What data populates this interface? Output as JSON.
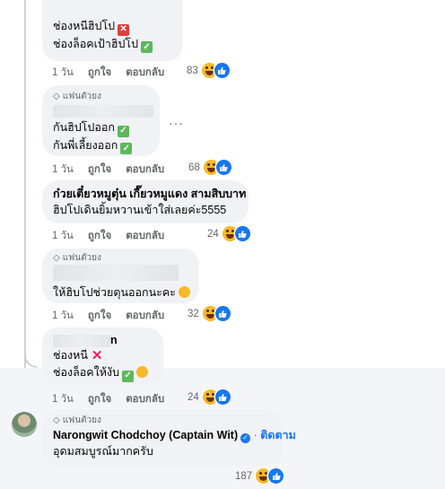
{
  "comments": [
    {
      "lines": [
        "ช่องหนีฮิปโป",
        "ช่องล็อคเป้าฮิปโป"
      ],
      "time": "1 วัน",
      "like_label": "ถูกใจ",
      "reply_label": "ตอบกลับ",
      "reaction_count": "83"
    },
    {
      "badge": "แฟนตัวยง",
      "lines": [
        "กันฮิปโปออก",
        "กันพี่เลี้ยงออก"
      ],
      "time": "1 วัน",
      "like_label": "ถูกใจ",
      "reply_label": "ตอบกลับ",
      "reaction_count": "68",
      "more": "···"
    },
    {
      "lines": [
        "ก๋วยเตี๋ยวหมูตุ๋น เกี๊ยวหมูแดง สามสิบบาท",
        "ฮิปโปเดินยิ้มหวานเข้าใส่เลยค่ะ5555"
      ],
      "time": "1 วัน",
      "like_label": "ถูกใจ",
      "reply_label": "ตอบกลับ",
      "reaction_count": "24"
    },
    {
      "badge": "แฟนตัวยง",
      "lines": [
        "ให้ฮิบโปช่วยดุนออกนะคะ"
      ],
      "time": "1 วัน",
      "like_label": "ถูกใจ",
      "reply_label": "ตอบกลับ",
      "reaction_count": "32"
    },
    {
      "name_tail": "n",
      "lines": [
        "ช่องหนี",
        "ช่องล็อคให้งับ"
      ],
      "time": "1 วัน",
      "like_label": "ถูกใจ",
      "reply_label": "ตอบกลับ",
      "reaction_count": "24"
    },
    {
      "badge": "แฟนตัวยง",
      "author": "Narongwit Chodchoy (Captain Wit)",
      "follow_label": "ติดตาม",
      "lines": [
        "อุดมสมบูรณ์มากครับ"
      ],
      "reaction_count": "187"
    }
  ],
  "icons": {
    "check": "check-mark-button-emoji",
    "cross": "cross-mark-emoji",
    "laugh": "grinning-squinting-face-emoji",
    "haha": "haha-reaction-icon",
    "like": "like-reaction-icon"
  },
  "colors": {
    "accent": "#1877f2",
    "bubble": "#f0f2f5",
    "meta": "#65676b"
  }
}
